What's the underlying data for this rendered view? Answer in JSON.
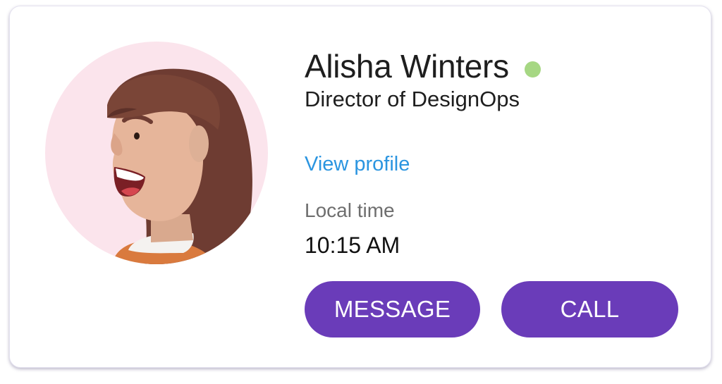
{
  "profile": {
    "name": "Alisha Winters",
    "title": "Director of DesignOps",
    "status": "online",
    "view_profile_label": "View profile",
    "local_time_label": "Local time",
    "local_time_value": "10:15 AM",
    "avatar_icon": "person-avatar-icon"
  },
  "actions": {
    "message_label": "MESSAGE",
    "call_label": "CALL"
  },
  "colors": {
    "accent": "#6a3cb9",
    "link": "#2b95e0",
    "status_online": "#a6d783",
    "avatar_background": "#fbe4ec"
  }
}
